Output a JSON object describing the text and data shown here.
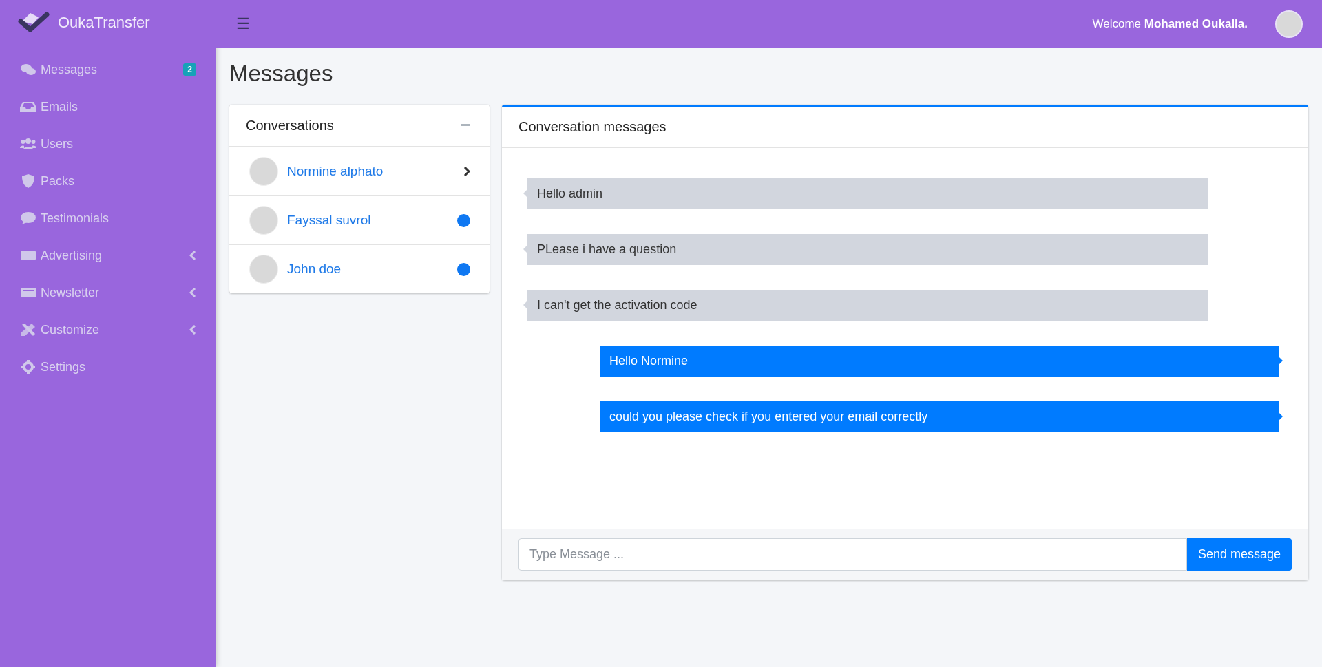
{
  "brand": {
    "name": "OukaTransfer"
  },
  "sidebar": {
    "items": [
      {
        "label": "Messages",
        "badge": "2",
        "has_submenu": false
      },
      {
        "label": "Emails",
        "has_submenu": false
      },
      {
        "label": "Users",
        "has_submenu": false
      },
      {
        "label": "Packs",
        "has_submenu": false
      },
      {
        "label": "Testimonials",
        "has_submenu": false
      },
      {
        "label": "Advertising",
        "has_submenu": true
      },
      {
        "label": "Newsletter",
        "has_submenu": true
      },
      {
        "label": "Customize",
        "has_submenu": true
      },
      {
        "label": "Settings",
        "has_submenu": false
      }
    ]
  },
  "header": {
    "menu_icon": "☰",
    "welcome": "Welcome **Mohamed Oukalla.**"
  },
  "page_title": "Messages",
  "conversations": {
    "title": "Conversations",
    "items": [
      {
        "name": "Normine alphato",
        "selected": true,
        "unread": false
      },
      {
        "name": "Fayssal suvrol",
        "selected": false,
        "unread": true
      },
      {
        "name": "John doe",
        "selected": false,
        "unread": true
      }
    ]
  },
  "chat": {
    "title": "Conversation messages",
    "messages": [
      {
        "kind": "received",
        "text": "Hello admin"
      },
      {
        "kind": "received",
        "text": "PLease i have a question"
      },
      {
        "kind": "received",
        "text": "I can't get the activation code"
      },
      {
        "kind": "sent",
        "text": "Hello Normine"
      },
      {
        "kind": "sent",
        "text": "could you please check if you entered your email correctly"
      }
    ],
    "input": {
      "placeholder": "Type Message ..."
    },
    "send_button": "Send message"
  }
}
